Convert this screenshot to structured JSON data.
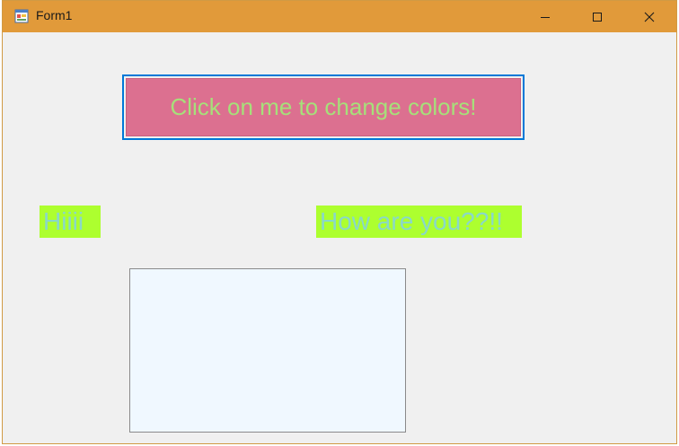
{
  "window": {
    "title": "Form1",
    "titlebar_color": "#e19a3a"
  },
  "caption_buttons": {
    "minimize_icon": "minimize-icon",
    "maximize_icon": "maximize-icon",
    "close_icon": "close-icon"
  },
  "form": {
    "color_button_label": "Click on me to change colors!",
    "color_button_back": "#dc7090",
    "color_button_fore": "#a6e07a",
    "label1_text": "Hiiii",
    "label2_text": "How are you??!!",
    "label_back": "#adff2f",
    "label_fore": "#89d8c8",
    "textbox_value": "",
    "textbox_back": "#f0f8ff"
  }
}
